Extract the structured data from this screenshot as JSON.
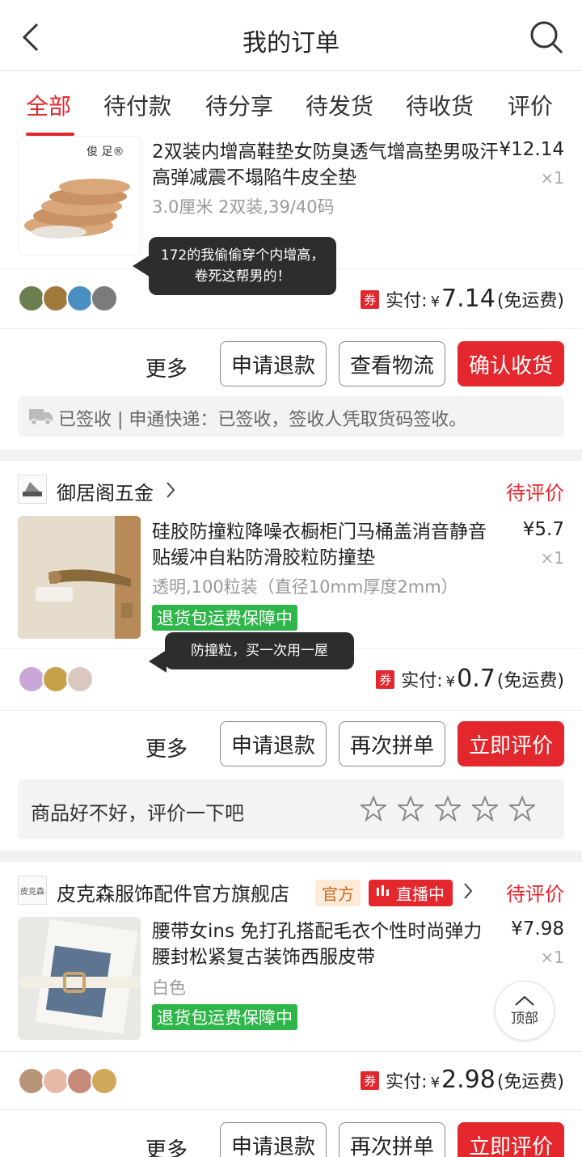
{
  "header": {
    "title": "我的订单"
  },
  "tabs": [
    "全部",
    "待付款",
    "待分享",
    "待发货",
    "待收货",
    "评价"
  ],
  "colors": {
    "accent": "#e4262d",
    "green_tag": "#2fb64a",
    "bubble": "#2d2d2d"
  },
  "order1": {
    "brand_mark": "俊 足®",
    "product_title": "2双装内增高鞋垫女防臭透气增高垫男吸汗高弹减震不塌陷牛皮全垫",
    "spec": "3.0厘米 2双装,39/40码",
    "price": "¥12.14",
    "qty": "×1",
    "bubble": "172的我偷偷穿个内增高，卷死这帮男的！",
    "coupon": "券",
    "paid_label": "实付:",
    "currency": "¥",
    "paid_amount": "7.14",
    "shipping": "(免运费)",
    "more": "更多",
    "buttons": [
      "申请退款",
      "查看物流",
      "确认收货"
    ],
    "logistics": "已签收 | 申通快递：已签收，签收人凭取货码签收。"
  },
  "order2": {
    "shop_name": "御居阁五金",
    "status": "待评价",
    "product_title": "硅胶防撞粒降噪衣橱柜门马桶盖消音静音贴缓冲自粘防滑胶粒防撞垫",
    "spec": "透明,100粒装（直径10mm厚度2mm）",
    "tag": "退货包运费保障中",
    "price": "¥5.7",
    "qty": "×1",
    "bubble": "防撞粒，买一次用一屋",
    "coupon": "券",
    "paid_label": "实付:",
    "currency": "¥",
    "paid_amount": "0.7",
    "shipping": "(免运费)",
    "more": "更多",
    "buttons": [
      "申请退款",
      "再次拼单",
      "立即评价"
    ],
    "review_prompt": "商品好不好，评价一下吧",
    "star_count": 5
  },
  "order3": {
    "shop_logo": "皮克森",
    "shop_name": "皮克森服饰配件官方旗舰店",
    "badge_official": "官方",
    "badge_live": "直播中",
    "status": "待评价",
    "product_title": "腰带女ins 免打孔搭配毛衣个性时尚弹力腰封松紧复古装饰西服皮带",
    "spec": "白色",
    "tag": "退货包运费保障中",
    "price": "¥7.98",
    "qty": "×1",
    "coupon": "券",
    "paid_label": "实付:",
    "currency": "¥",
    "paid_amount": "2.98",
    "shipping": "(免运费)",
    "more": "更多",
    "buttons": [
      "申请退款",
      "再次拼单",
      "立即评价"
    ]
  },
  "float_top": "顶部"
}
